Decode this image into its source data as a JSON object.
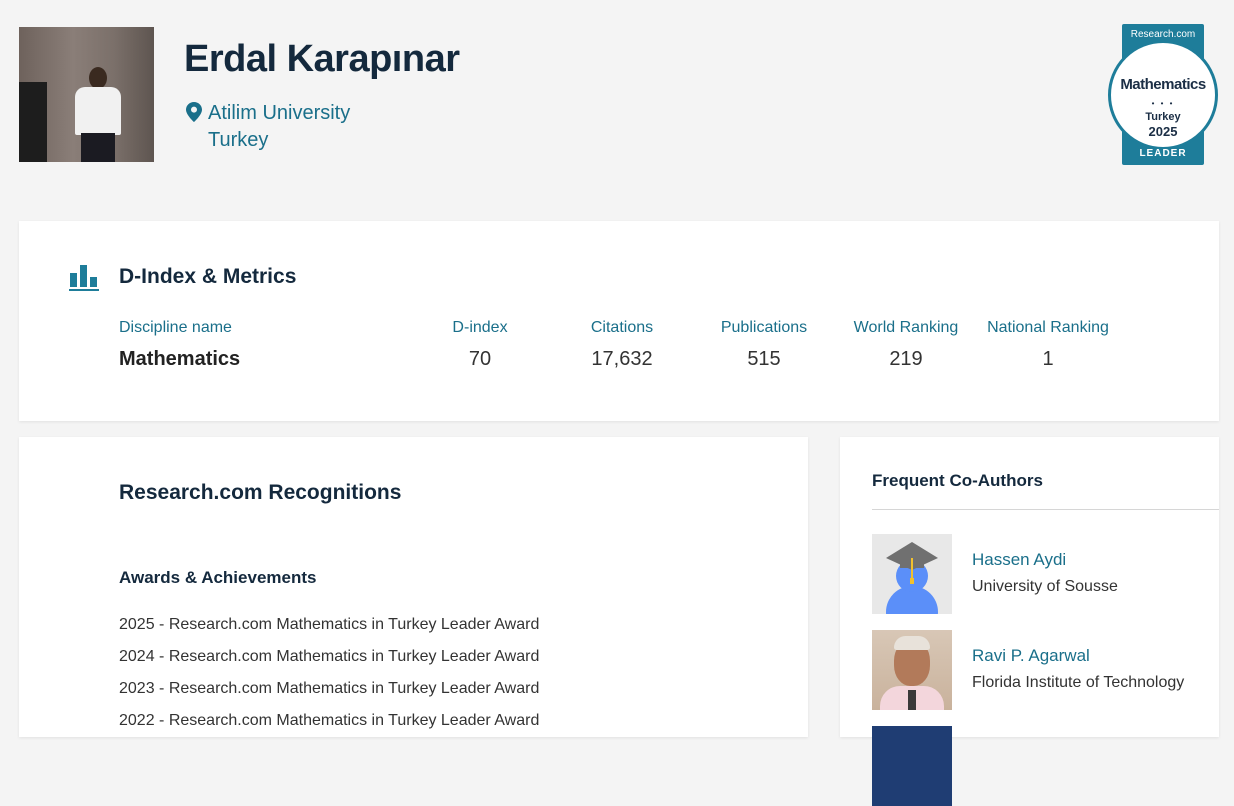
{
  "profile": {
    "name": "Erdal Karapınar",
    "institution": "Atilim University",
    "country": "Turkey"
  },
  "badge": {
    "brand": "Research.com",
    "subject": "Mathematics",
    "dots": "• • •",
    "country": "Turkey",
    "year": "2025",
    "level": "LEADER"
  },
  "metrics": {
    "title": "D-Index & Metrics",
    "headers": {
      "discipline": "Discipline name",
      "dindex": "D-index",
      "citations": "Citations",
      "publications": "Publications",
      "world": "World Ranking",
      "national": "National Ranking"
    },
    "row": {
      "discipline": "Mathematics",
      "dindex": "70",
      "citations": "17,632",
      "publications": "515",
      "world": "219",
      "national": "1"
    }
  },
  "recognitions": {
    "title": "Research.com Recognitions",
    "awards_title": "Awards & Achievements",
    "awards": [
      "2025 - Research.com Mathematics in Turkey Leader Award",
      "2024 - Research.com Mathematics in Turkey Leader Award",
      "2023 - Research.com Mathematics in Turkey Leader Award",
      "2022 - Research.com Mathematics in Turkey Leader Award"
    ]
  },
  "coauthors": {
    "title": "Frequent Co-Authors",
    "items": [
      {
        "name": "Hassen Aydi",
        "institution": "University of Sousse"
      },
      {
        "name": "Ravi P. Agarwal",
        "institution": "Florida Institute of Technology"
      }
    ]
  },
  "colors": {
    "accent": "#1a6f8a",
    "heading": "#14293d",
    "badge": "#1e7d9a"
  }
}
